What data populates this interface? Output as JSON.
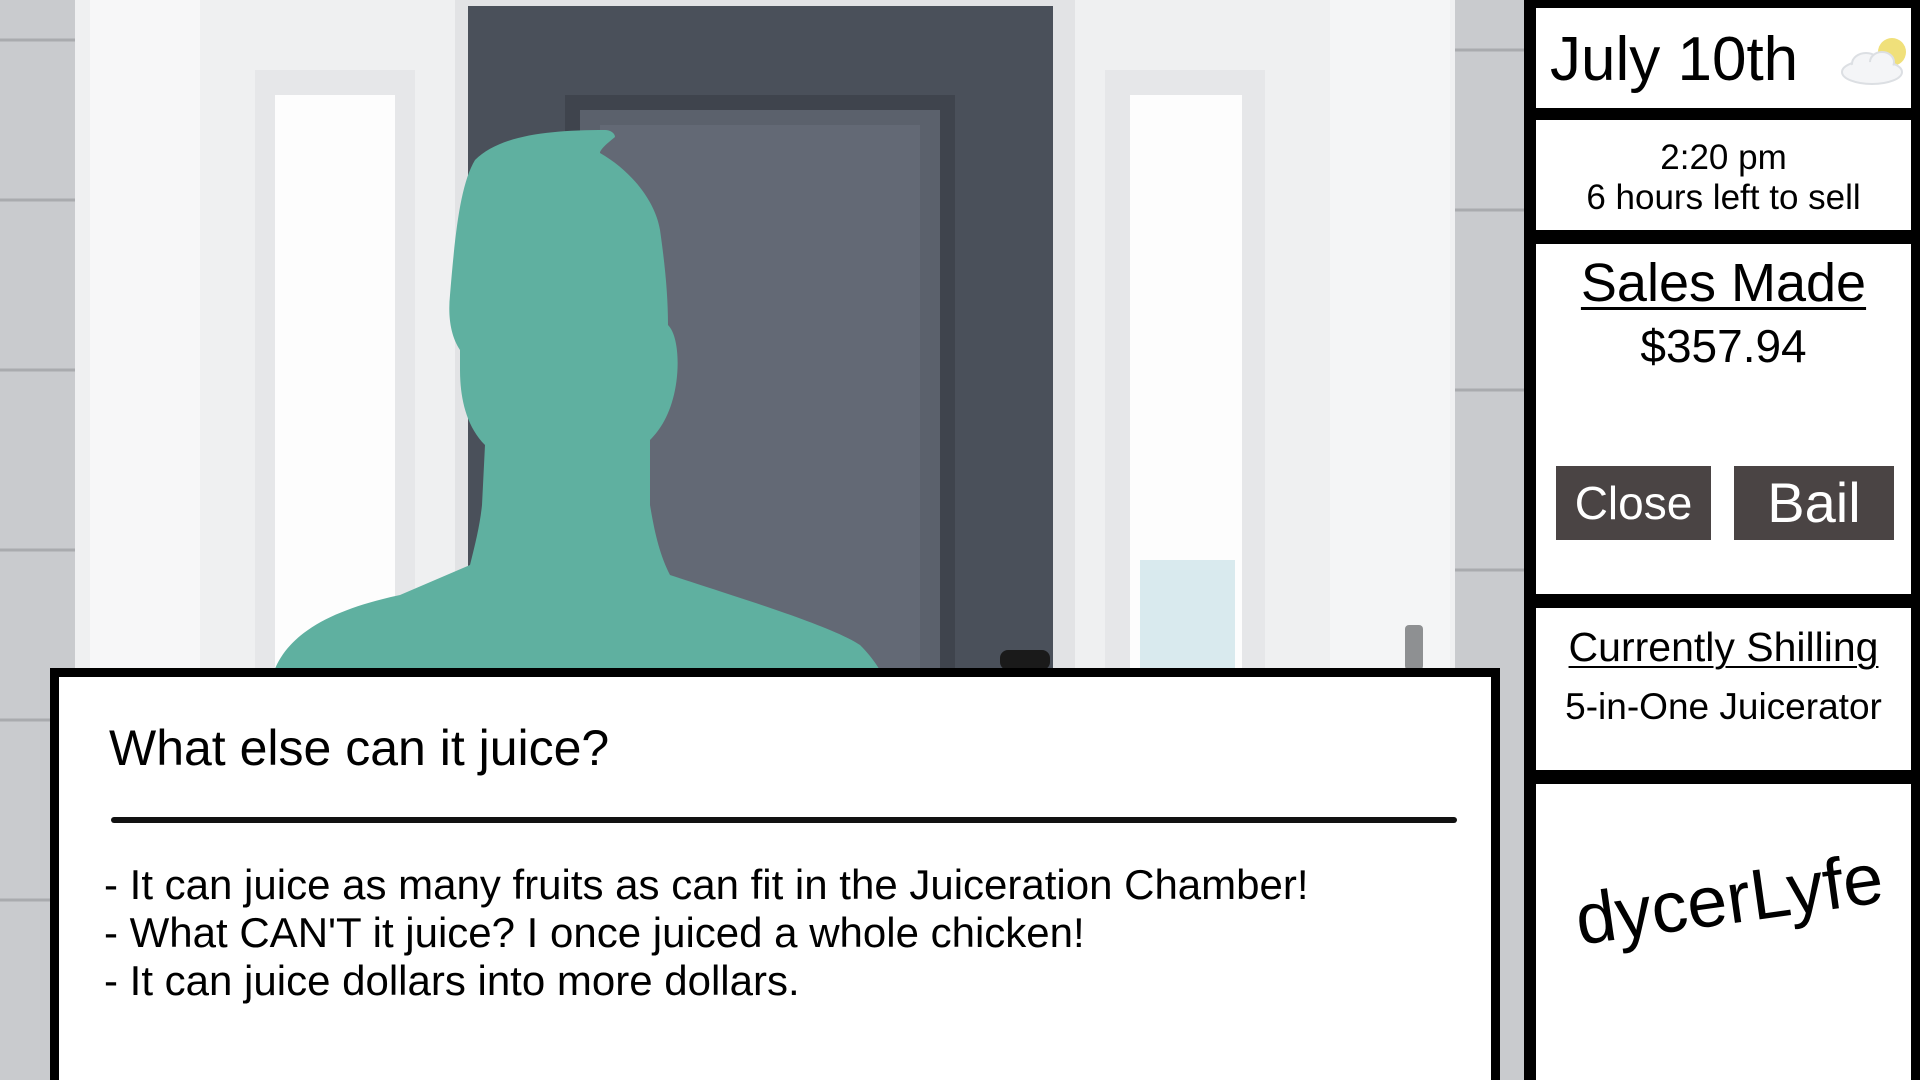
{
  "scene": {
    "background": "front-door-porch",
    "character": "customer-silhouette",
    "colors": {
      "silhouette": "#5fb0a0",
      "door": "#4d545f"
    }
  },
  "dialog": {
    "question": "What else can it juice?",
    "answers": [
      "- It can juice as many fruits as can fit in the Juiceration Chamber!",
      "- What CAN'T it juice? I once juiced a whole chicken!",
      "- It can juice dollars into more dollars."
    ]
  },
  "panel": {
    "date": "July 10th",
    "weather_icon": "partly-sunny-icon",
    "time": "2:20 pm",
    "time_left": "6 hours left to sell",
    "sales_title": "Sales Made",
    "sales_amount": "$357.94",
    "close_label": "Close",
    "bail_label": "Bail",
    "shilling_title": "Currently Shilling",
    "shilling_product": "5-in-One Juicerator",
    "username": "dycerLyfe",
    "colors": {
      "button_bg": "#4a4444",
      "button_text": "#ffffff"
    }
  }
}
